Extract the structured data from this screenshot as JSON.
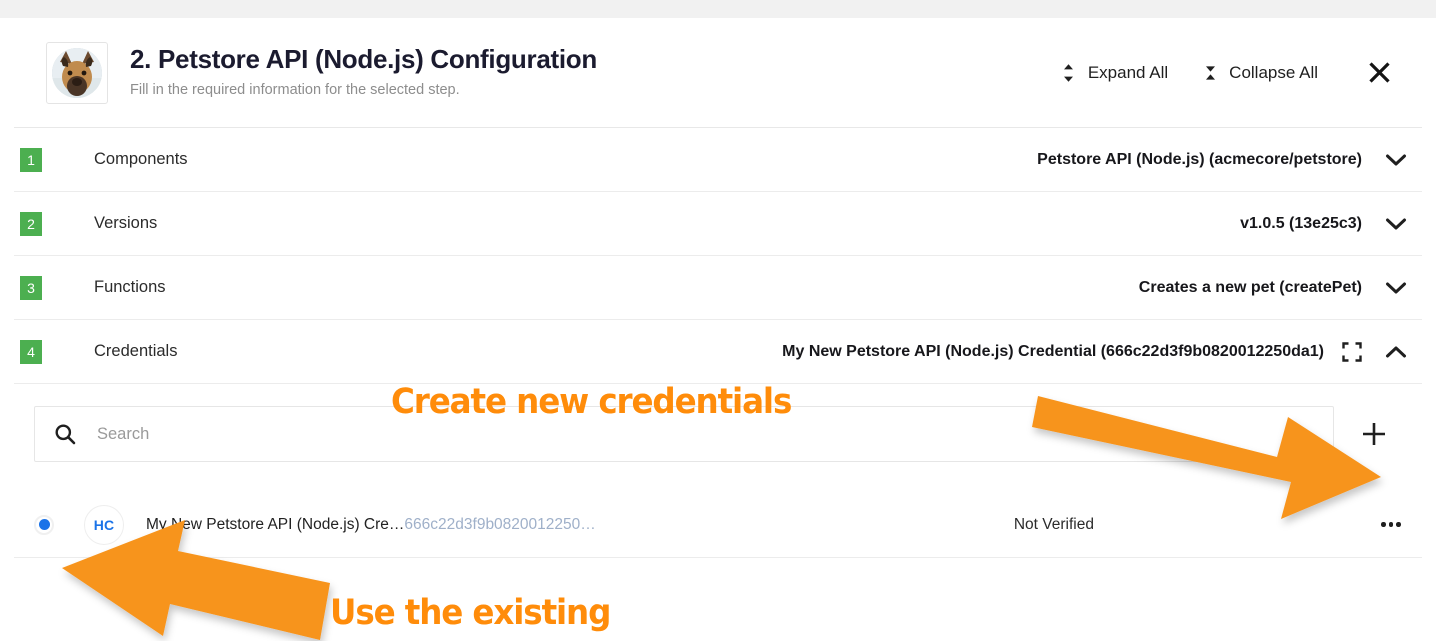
{
  "header": {
    "title": "2. Petstore API (Node.js) Configuration",
    "subtitle": "Fill in the required information for the selected step.",
    "avatar_icon": "dog-avatar-photo",
    "expand_all_label": "Expand All",
    "expand_all_icon": "expand-vertical-icon",
    "collapse_all_label": "Collapse All",
    "collapse_all_icon": "collapse-vertical-icon",
    "close_icon": "close-icon"
  },
  "steps": [
    {
      "number": "1",
      "label": "Components",
      "value": "Petstore API (Node.js) (acmecore/petstore)",
      "chevron": "chevron-down-icon",
      "expanded": false,
      "has_fullscreen_icon": false
    },
    {
      "number": "2",
      "label": "Versions",
      "value": "v1.0.5 (13e25c3)",
      "chevron": "chevron-down-icon",
      "expanded": false,
      "has_fullscreen_icon": false
    },
    {
      "number": "3",
      "label": "Functions",
      "value": "Creates a new pet (createPet)",
      "chevron": "chevron-down-icon",
      "expanded": false,
      "has_fullscreen_icon": false
    },
    {
      "number": "4",
      "label": "Credentials",
      "value": "My New Petstore API (Node.js) Credential (666c22d3f9b0820012250da1)",
      "chevron": "chevron-up-icon",
      "expanded": true,
      "has_fullscreen_icon": true,
      "fullscreen_icon": "fullscreen-expand-icon"
    }
  ],
  "credentials_panel": {
    "search": {
      "icon": "search-icon",
      "value": "",
      "placeholder": "Search"
    },
    "add_button_icon": "plus-icon",
    "rows": [
      {
        "selected": true,
        "radio_icon": "radio-selected-icon",
        "avatar_initials": "HC",
        "name": "My New Petstore API (Node.js) Cre…",
        "id": "666c22d3f9b0820012250…",
        "status": "Not Verified",
        "menu_icon": "kebab-menu-icon"
      }
    ]
  },
  "annotations": [
    {
      "text": "Create new credentials",
      "color": "#FF8C0A",
      "arrow": "arrow-down-right"
    },
    {
      "text": "Use the existing",
      "color": "#FF8C0A",
      "arrow": "arrow-left"
    }
  ],
  "colors": {
    "badge_green": "#4caf50",
    "annotation_orange": "#FF8C0A",
    "radio_blue": "#1a73e8"
  }
}
